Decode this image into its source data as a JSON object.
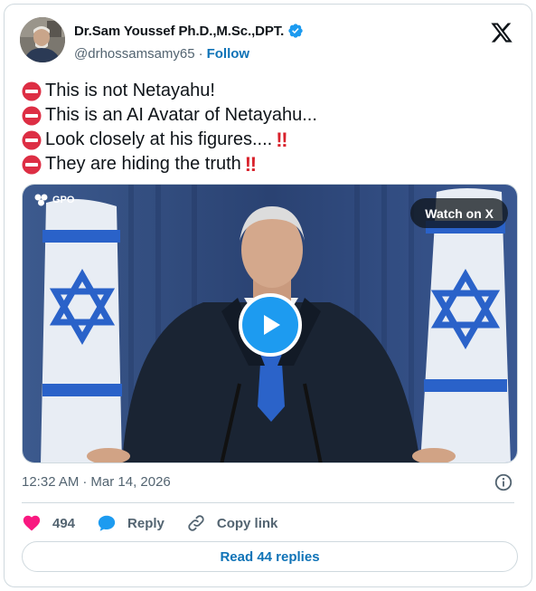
{
  "author": {
    "name": "Dr.Sam Youssef Ph.D.,M.Sc.,DPT.",
    "handle": "@drhossamsamy65",
    "separator": "·",
    "follow_label": "Follow",
    "verified": true
  },
  "tweet": {
    "lines": [
      {
        "text": "This is not Netayahu!",
        "bangs": ""
      },
      {
        "text": "This is an AI Avatar of Netayahu...",
        "bangs": ""
      },
      {
        "text": "Look closely at his figures....",
        "bangs": "‼"
      },
      {
        "text": "They are hiding the truth",
        "bangs": "‼"
      }
    ]
  },
  "media": {
    "watermark": "GPO",
    "watch_label": "Watch on X"
  },
  "meta": {
    "time": "12:32 AM",
    "separator": "·",
    "date": "Mar 14, 2026"
  },
  "actions": {
    "likes": "494",
    "reply_label": "Reply",
    "copy_label": "Copy link"
  },
  "read_replies_label": "Read 44 replies",
  "colors": {
    "accent": "#1d9bf0",
    "link": "#0f73b7",
    "like": "#f91880",
    "muted": "#536471"
  }
}
